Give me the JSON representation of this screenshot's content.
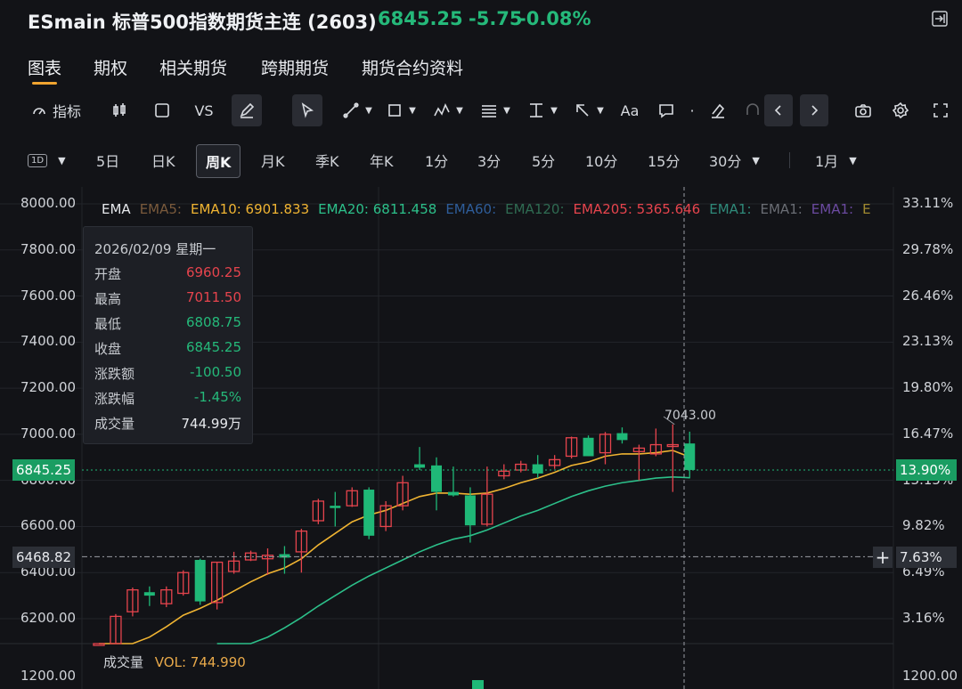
{
  "header": {
    "symbol_title": "ESmain 标普500指数期货主连 (2603)",
    "last_price": "6845.25",
    "change": "-5.75",
    "change_pct": "-0.08%"
  },
  "tabs": [
    "图表",
    "期权",
    "相关期货",
    "跨期期货",
    "期货合约资料"
  ],
  "toolbar": {
    "indicator_label": "指标",
    "vs_label": "VS",
    "text_label": "Aa"
  },
  "periods": {
    "interval_button": "1D",
    "items": [
      "5日",
      "日K",
      "周K",
      "月K",
      "季K",
      "年K",
      "1分",
      "3分",
      "5分",
      "10分",
      "15分",
      "30分"
    ],
    "active": "周K",
    "range": "1月"
  },
  "ema_legend": [
    {
      "text": "EMA",
      "color": "#e6e8ec"
    },
    {
      "text": "EMA5:",
      "color": "#7a5a3c"
    },
    {
      "text": "EMA10: 6901.833",
      "color": "#f0b432"
    },
    {
      "text": "EMA20: 6811.458",
      "color": "#2cc08a"
    },
    {
      "text": "EMA60:",
      "color": "#2e5d9a"
    },
    {
      "text": "EMA120:",
      "color": "#2f6b52"
    },
    {
      "text": "EMA205: 5365.646",
      "color": "#e6444d"
    },
    {
      "text": "EMA1:",
      "color": "#2f8a7a"
    },
    {
      "text": "EMA1:",
      "color": "#6a6d74"
    },
    {
      "text": "EMA1:",
      "color": "#6b4aa0"
    },
    {
      "text": "E",
      "color": "#a08a30"
    }
  ],
  "tooltip": {
    "date": "2026/02/09 星期一",
    "rows": [
      {
        "label": "开盘",
        "value": "6960.25",
        "color": "#e6444d"
      },
      {
        "label": "最高",
        "value": "7011.50",
        "color": "#e6444d"
      },
      {
        "label": "最低",
        "value": "6808.75",
        "color": "#25b97a"
      },
      {
        "label": "收盘",
        "value": "6845.25",
        "color": "#25b97a"
      },
      {
        "label": "涨跌额",
        "value": "-100.50",
        "color": "#25b97a"
      },
      {
        "label": "涨跌幅",
        "value": "-1.45%",
        "color": "#25b97a"
      },
      {
        "label": "成交量",
        "value": "744.99万",
        "color": "#e6e8ec"
      }
    ]
  },
  "price_tag": "6845.25",
  "pct_tag": "13.90%",
  "crosshair_price_tag": "6468.82",
  "crosshair_pct_tag": "7.63%",
  "peak_label": "7043.00",
  "volume": {
    "label": "成交量",
    "value": "VOL: 744.990"
  },
  "colors": {
    "up": "#e6444d",
    "down": "#1fb877",
    "ema10": "#f0b432",
    "ema20": "#2cc08a"
  },
  "chart_data": {
    "type": "candlestick",
    "y_left_ticks": [
      "8000.00",
      "7800.00",
      "7600.00",
      "7400.00",
      "7200.00",
      "7000.00",
      "6800.00",
      "6600.00",
      "6400.00",
      "6200.00"
    ],
    "y_right_ticks": [
      "33.11%",
      "29.78%",
      "26.46%",
      "23.13%",
      "19.80%",
      "16.47%",
      "13.15%",
      "9.82%",
      "6.49%",
      "3.16%"
    ],
    "volume_tick_left": "1200.00",
    "volume_tick_right": "1200.00",
    "ylim": [
      6000,
      8000
    ],
    "candles": [
      {
        "o": 6060,
        "h": 6070,
        "l": 6000,
        "c": 6050,
        "up": true
      },
      {
        "o": 6080,
        "h": 6220,
        "l": 6020,
        "c": 6210,
        "up": true
      },
      {
        "o": 6230,
        "h": 6335,
        "l": 6210,
        "c": 6325,
        "up": true
      },
      {
        "o": 6315,
        "h": 6340,
        "l": 6255,
        "c": 6300,
        "up": false
      },
      {
        "o": 6265,
        "h": 6340,
        "l": 6250,
        "c": 6325,
        "up": true
      },
      {
        "o": 6310,
        "h": 6410,
        "l": 6300,
        "c": 6400,
        "up": true
      },
      {
        "o": 6455,
        "h": 6460,
        "l": 6260,
        "c": 6275,
        "up": false
      },
      {
        "o": 6270,
        "h": 6445,
        "l": 6240,
        "c": 6445,
        "up": true
      },
      {
        "o": 6405,
        "h": 6490,
        "l": 6395,
        "c": 6450,
        "up": true
      },
      {
        "o": 6455,
        "h": 6495,
        "l": 6450,
        "c": 6485,
        "up": true
      },
      {
        "o": 6475,
        "h": 6505,
        "l": 6390,
        "c": 6460,
        "up": true
      },
      {
        "o": 6480,
        "h": 6515,
        "l": 6395,
        "c": 6465,
        "up": false
      },
      {
        "o": 6490,
        "h": 6590,
        "l": 6400,
        "c": 6580,
        "up": true
      },
      {
        "o": 6625,
        "h": 6720,
        "l": 6610,
        "c": 6710,
        "up": true
      },
      {
        "o": 6680,
        "h": 6750,
        "l": 6600,
        "c": 6690,
        "up": false
      },
      {
        "o": 6690,
        "h": 6770,
        "l": 6685,
        "c": 6755,
        "up": true
      },
      {
        "o": 6760,
        "h": 6770,
        "l": 6545,
        "c": 6560,
        "up": false
      },
      {
        "o": 6600,
        "h": 6710,
        "l": 6580,
        "c": 6690,
        "up": true
      },
      {
        "o": 6690,
        "h": 6820,
        "l": 6670,
        "c": 6790,
        "up": true
      },
      {
        "o": 6870,
        "h": 6945,
        "l": 6845,
        "c": 6855,
        "up": false
      },
      {
        "o": 6865,
        "h": 6900,
        "l": 6670,
        "c": 6750,
        "up": false
      },
      {
        "o": 6750,
        "h": 6860,
        "l": 6730,
        "c": 6735,
        "up": false
      },
      {
        "o": 6735,
        "h": 6770,
        "l": 6530,
        "c": 6605,
        "up": false
      },
      {
        "o": 6610,
        "h": 6860,
        "l": 6600,
        "c": 6740,
        "up": true
      },
      {
        "o": 6820,
        "h": 6870,
        "l": 6805,
        "c": 6840,
        "up": true
      },
      {
        "o": 6845,
        "h": 6885,
        "l": 6835,
        "c": 6870,
        "up": true
      },
      {
        "o": 6870,
        "h": 6910,
        "l": 6810,
        "c": 6830,
        "up": false
      },
      {
        "o": 6865,
        "h": 6910,
        "l": 6850,
        "c": 6890,
        "up": true
      },
      {
        "o": 6905,
        "h": 6990,
        "l": 6895,
        "c": 6985,
        "up": true
      },
      {
        "o": 6985,
        "h": 6995,
        "l": 6905,
        "c": 6905,
        "up": false
      },
      {
        "o": 6920,
        "h": 7010,
        "l": 6870,
        "c": 7000,
        "up": true
      },
      {
        "o": 7005,
        "h": 7030,
        "l": 6960,
        "c": 6975,
        "up": false
      },
      {
        "o": 6925,
        "h": 6955,
        "l": 6800,
        "c": 6940,
        "up": true
      },
      {
        "o": 6915,
        "h": 7025,
        "l": 6905,
        "c": 6955,
        "up": true
      },
      {
        "o": 6955,
        "h": 7043,
        "l": 6750,
        "c": 6955,
        "up": true
      },
      {
        "o": 6960.25,
        "h": 7011.5,
        "l": 6808.75,
        "c": 6845.25,
        "up": false
      }
    ],
    "ema10": [
      6000,
      6030,
      6080,
      6120,
      6165,
      6215,
      6245,
      6280,
      6320,
      6360,
      6395,
      6420,
      6460,
      6520,
      6570,
      6620,
      6650,
      6670,
      6700,
      6730,
      6745,
      6745,
      6740,
      6745,
      6765,
      6790,
      6810,
      6835,
      6865,
      6880,
      6905,
      6915,
      6915,
      6920,
      6930,
      6901.833
    ],
    "ema20": [
      null,
      null,
      null,
      null,
      null,
      null,
      null,
      6000,
      6040,
      6080,
      6120,
      6160,
      6205,
      6255,
      6300,
      6345,
      6385,
      6420,
      6455,
      6490,
      6520,
      6545,
      6560,
      6585,
      6615,
      6645,
      6670,
      6700,
      6730,
      6755,
      6775,
      6790,
      6800,
      6810,
      6815,
      6811.458
    ]
  }
}
